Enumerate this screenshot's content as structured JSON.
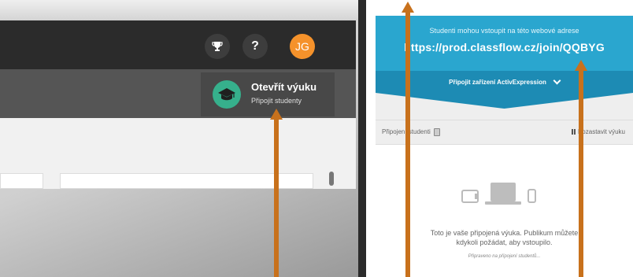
{
  "header": {
    "avatar_initials": "JG",
    "help_label": "?"
  },
  "open_lesson": {
    "title": "Otevřít výuku",
    "subtitle": "Připojit studenty"
  },
  "join_panel": {
    "instruction": "Studenti mohou vstoupit na této webové adrese",
    "url": "https://prod.classflow.cz/join/QQBYG",
    "device_label": "Připojit zařízení ActivExpression",
    "students_label": "Připojení studenti",
    "pause_label": "Pozastavit výuku",
    "empty_message_line1": "Toto je vaše připojená výuka. Publikum můžete",
    "empty_message_line2": "kdykoli požádat, aby vstoupilo.",
    "waiting_text": "Připraveno na připojení studentů..."
  },
  "colors": {
    "brand_blue": "#2aa6cf",
    "brand_blue_dark": "#1d8bb4",
    "avatar_orange": "#f5922b",
    "lesson_green": "#36b08c",
    "arrow_orange": "#c8711c"
  },
  "icons": {
    "trophy": "trophy-icon",
    "help": "question-icon",
    "lesson": "graduation-cap-icon",
    "devices": "devices-icon",
    "pause": "pause-icon"
  }
}
